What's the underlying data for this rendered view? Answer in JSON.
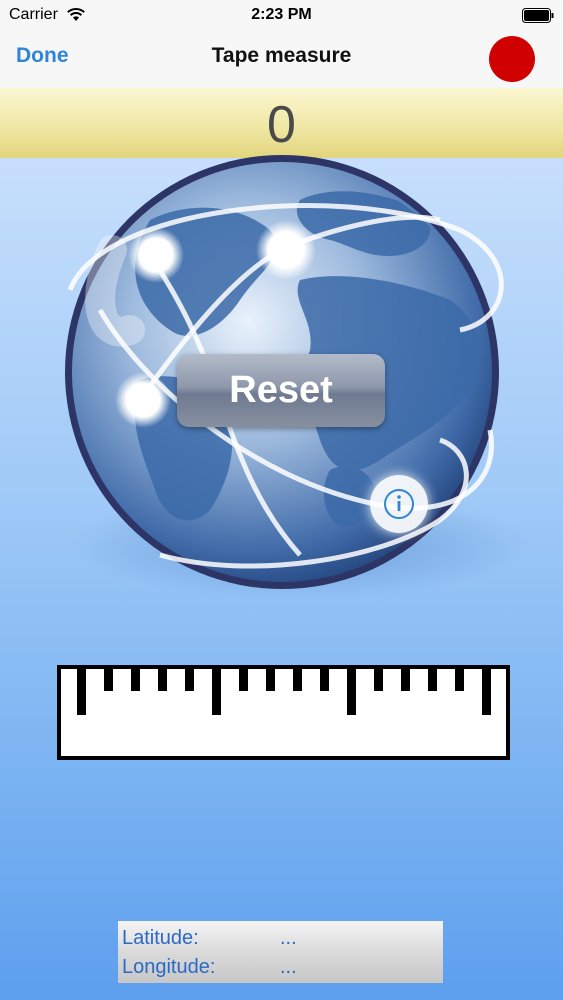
{
  "status_bar": {
    "carrier": "Carrier",
    "time": "2:23 PM",
    "wifi_icon": "wifi-icon",
    "battery_icon": "battery-icon"
  },
  "nav_bar": {
    "done_label": "Done",
    "title": "Tape measure",
    "record_icon": "record-dot-icon",
    "record_color": "#d10000"
  },
  "distance": {
    "value": "0"
  },
  "globe": {
    "reset_label": "Reset",
    "info_icon": "info-icon"
  },
  "ruler_icon": "ruler-icon",
  "location": {
    "latitude_label": "Latitude:",
    "latitude_value": "...",
    "longitude_label": "Longitude:",
    "longitude_value": "..."
  },
  "colors": {
    "accent": "#2f86d6",
    "location_text": "#2a69c8",
    "band": "#efe6a2"
  }
}
